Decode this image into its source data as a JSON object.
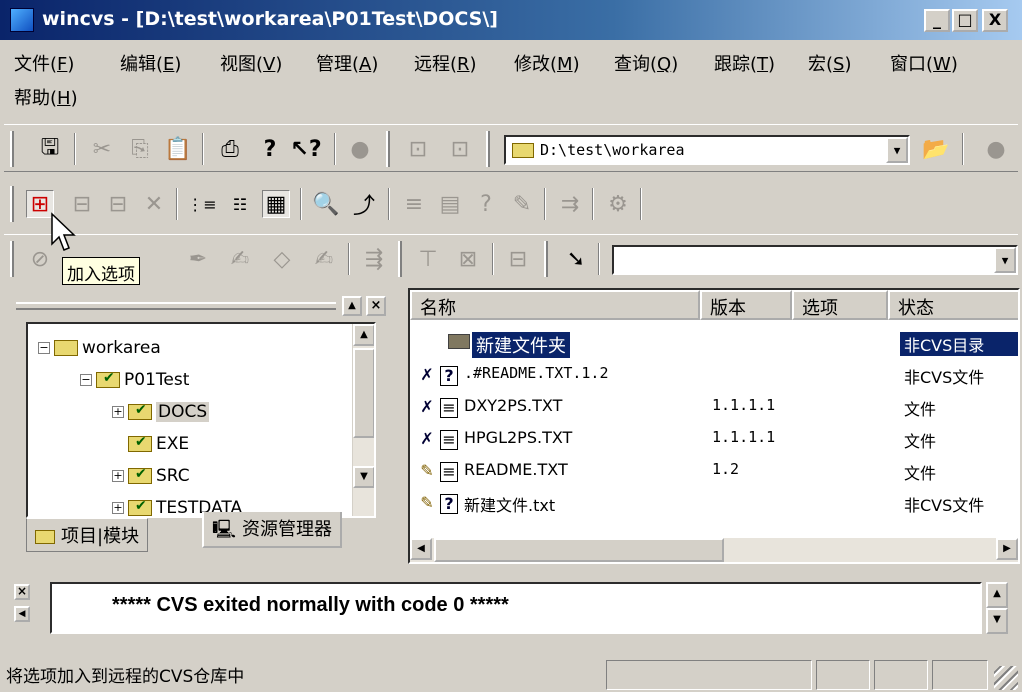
{
  "window": {
    "title": "wincvs - [D:\\test\\workarea\\P01Test\\DOCS\\]",
    "buttons": [
      "_",
      "□",
      "X"
    ]
  },
  "menu": [
    {
      "label": "文件(",
      "key": "F",
      "suffix": ")"
    },
    {
      "label": "编辑(",
      "key": "E",
      "suffix": ")"
    },
    {
      "label": "视图(",
      "key": "V",
      "suffix": ")"
    },
    {
      "label": "管理(",
      "key": "A",
      "suffix": ")"
    },
    {
      "label": "远程(",
      "key": "R",
      "suffix": ")"
    },
    {
      "label": "修改(",
      "key": "M",
      "suffix": ")"
    },
    {
      "label": "查询(",
      "key": "Q",
      "suffix": ")"
    },
    {
      "label": "跟踪(",
      "key": "T",
      "suffix": ")"
    },
    {
      "label": "宏(",
      "key": "S",
      "suffix": ")"
    },
    {
      "label": "窗口(",
      "key": "W",
      "suffix": ")"
    },
    {
      "label": "帮助(",
      "key": "H",
      "suffix": ")"
    }
  ],
  "toolbar": {
    "path_combo": "D:\\test\\workarea",
    "tooltip": "加入选项"
  },
  "tree": {
    "nodes": [
      {
        "label": "workarea"
      },
      {
        "label": "P01Test"
      },
      {
        "label": "DOCS"
      },
      {
        "label": "EXE"
      },
      {
        "label": "SRC"
      },
      {
        "label": "TESTDATA"
      }
    ],
    "tabs": [
      "项目|模块",
      "资源管理器"
    ]
  },
  "files": {
    "columns": [
      "名称",
      "版本",
      "选项",
      "状态"
    ],
    "rows": [
      {
        "name": "新建文件夹",
        "version": "",
        "option": "",
        "status": "非CVS目录"
      },
      {
        "name": ".#README.TXT.1.2",
        "version": "",
        "option": "",
        "status": "非CVS文件"
      },
      {
        "name": "DXY2PS.TXT",
        "version": "1.1.1.1",
        "option": "",
        "status": "文件"
      },
      {
        "name": "HPGL2PS.TXT",
        "version": "1.1.1.1",
        "option": "",
        "status": "文件"
      },
      {
        "name": "README.TXT",
        "version": "1.2",
        "option": "",
        "status": "文件"
      },
      {
        "name": "新建文件.txt",
        "version": "",
        "option": "",
        "status": "非CVS文件"
      }
    ]
  },
  "output": {
    "text": "***** CVS exited normally with code 0 *****"
  },
  "status": {
    "text": "将选项加入到远程的CVS仓库中"
  },
  "colors": {
    "selection": "#0a246a",
    "titlebar": "#0a246a",
    "face": "#d4d0c8"
  }
}
